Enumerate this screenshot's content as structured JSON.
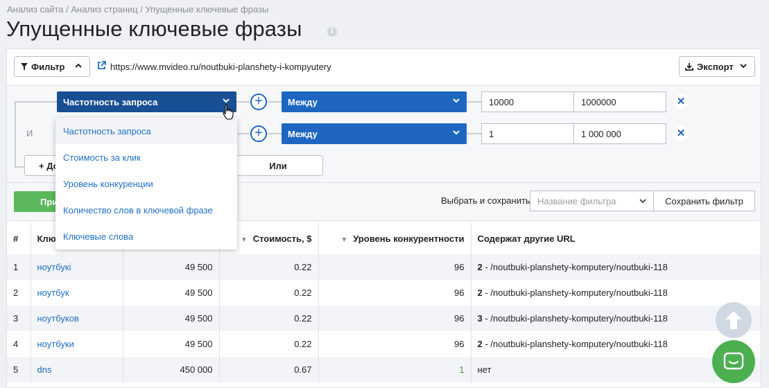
{
  "breadcrumb": "Анализ сайта / Анализ страниц / Упущенные ключевые фразы",
  "title": "Упущенные ключевые фразы",
  "toolbar": {
    "filter_label": "Фильтр",
    "url": "https://www.mvideo.ru/noutbuki-planshety-i-kompyutery",
    "export_label": "Экспорт"
  },
  "filters": {
    "and_label": "И",
    "rows": [
      {
        "field": "Частотность запроса",
        "condition": "Между",
        "from": "10000",
        "to": "1000000"
      },
      {
        "field": "",
        "condition": "Между",
        "from": "1",
        "to": "1 000 000"
      }
    ],
    "add_label": "+ До",
    "or_label": "Или",
    "apply_label": "При",
    "save_prompt": "Выбрать и сохранить",
    "name_placeholder": "Название фильтра",
    "save_button": "Сохранить фильтр"
  },
  "dropdown": {
    "items": [
      "Частотность запроса",
      "Стоимость за клик",
      "Уровень конкуренции",
      "Количество слов в ключевой фразе",
      "Ключевые слова"
    ],
    "active_index": 0
  },
  "table": {
    "headers": [
      "#",
      "Клю",
      "",
      "Стоимость, $",
      "Уровень конкурентности",
      "Содержат другие URL"
    ],
    "rows": [
      {
        "n": "1",
        "kw": "ноутбукі",
        "freq": "49 500",
        "cost": "0.22",
        "comp": "96",
        "urls_bold": "2",
        "urls": " - /noutbuki-planshety-komputery/noutbuki-118"
      },
      {
        "n": "2",
        "kw": "ноутбук",
        "freq": "49 500",
        "cost": "0.22",
        "comp": "96",
        "urls_bold": "2",
        "urls": " - /noutbuki-planshety-komputery/noutbuki-118"
      },
      {
        "n": "3",
        "kw": "ноутбуков",
        "freq": "49 500",
        "cost": "0.22",
        "comp": "96",
        "urls_bold": "3",
        "urls": " - /noutbuki-planshety-komputery/noutbuki-118"
      },
      {
        "n": "4",
        "kw": "ноутбуки",
        "freq": "49 500",
        "cost": "0.22",
        "comp": "96",
        "urls_bold": "2",
        "urls": " - /noutbuki-planshety-komputery/noutbuki-118"
      },
      {
        "n": "5",
        "kw": "dns",
        "freq": "450 000",
        "cost": "0.67",
        "comp": "1",
        "urls_bold": "",
        "urls": "нет"
      }
    ]
  },
  "colors": {
    "primary": "#1f66c1",
    "primary_dark": "#174f92",
    "apply_green": "#5cb85c",
    "chat_green": "#4caf50"
  }
}
